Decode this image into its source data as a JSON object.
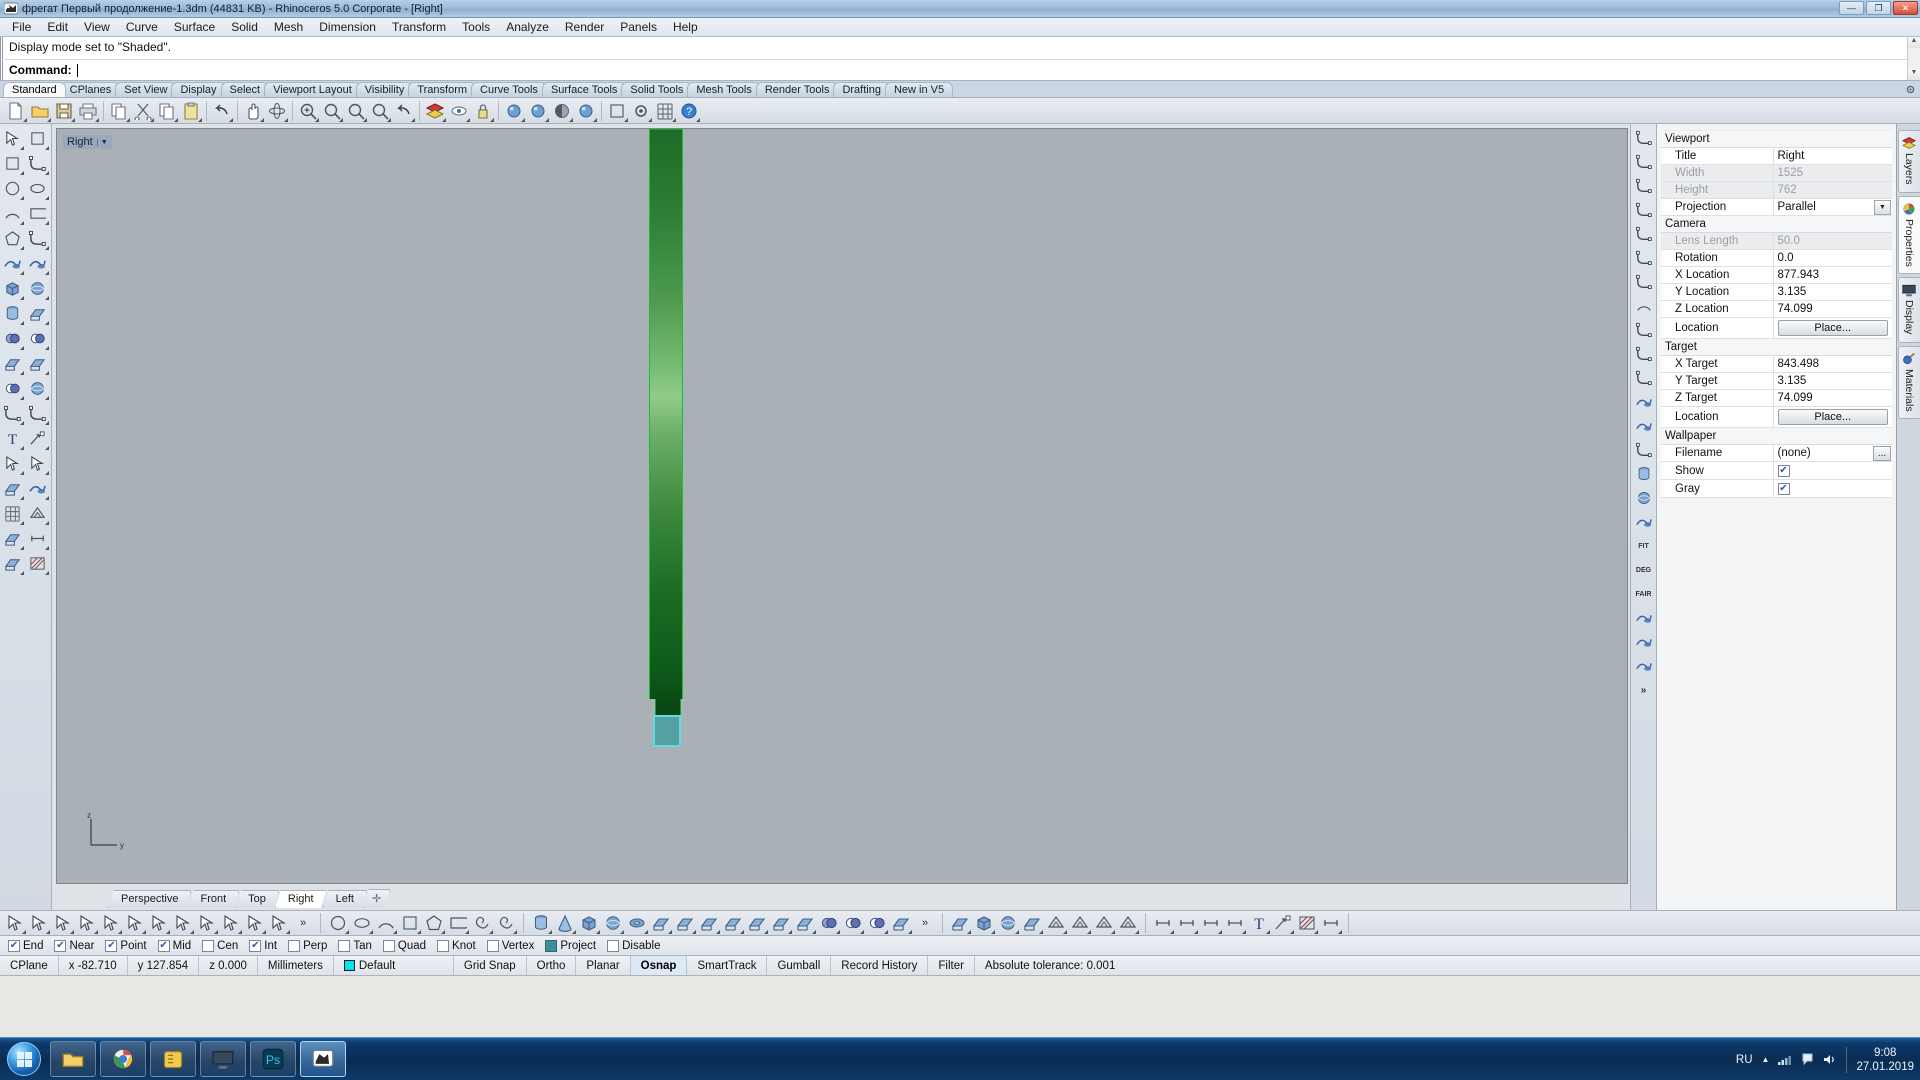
{
  "window": {
    "title": "фрегат Первый продолжение-1.3dm (44831 KB) - Rhinoceros  5.0 Corporate - [Right]",
    "icon": "rhino-app-icon",
    "minimize": "—",
    "maximize": "❐",
    "close": "✕"
  },
  "menubar": {
    "items": [
      "File",
      "Edit",
      "View",
      "Curve",
      "Surface",
      "Solid",
      "Mesh",
      "Dimension",
      "Transform",
      "Tools",
      "Analyze",
      "Render",
      "Panels",
      "Help"
    ]
  },
  "command": {
    "history": "Display mode set to \"Shaded\".",
    "prompt_label": "Command:",
    "input_value": "",
    "scroll_up": "▲",
    "scroll_down": "▼"
  },
  "toolbar_tabs": {
    "items": [
      "Standard",
      "CPlanes",
      "Set View",
      "Display",
      "Select",
      "Viewport Layout",
      "Visibility",
      "Transform",
      "Curve Tools",
      "Surface Tools",
      "Solid Tools",
      "Mesh Tools",
      "Render Tools",
      "Drafting",
      "New in V5"
    ],
    "active": "Standard"
  },
  "main_toolbar": {
    "buttons": [
      "new-file-icon",
      "open-folder-icon",
      "save-icon",
      "print-icon",
      "copy-to-clipboard-icon",
      "cut-scissors-icon",
      "copy-icon",
      "paste-icon",
      "undo-arrow-icon",
      "pan-hand-icon",
      "rotate-view-icon",
      "zoom-in-icon",
      "zoom-window-icon",
      "zoom-extents-icon",
      "zoom-selected-icon",
      "undo-view-icon",
      "layers-icon",
      "hide-objects-icon",
      "lock-objects-icon",
      "render-icon",
      "render-preview-icon",
      "shaded-view-icon",
      "rendered-view-icon",
      "properties-icon",
      "options-gear-icon",
      "grid-snap-icon",
      "help-icon"
    ]
  },
  "viewport": {
    "label": "Right",
    "label_dropdown": "▼",
    "background_color": "#a9b0b6",
    "axis": {
      "z_label": "z",
      "y_label": "y"
    },
    "object": {
      "name": "shaded-green-extrusion",
      "edge_color": "#18c030",
      "selected_block_color": "#55a0a3",
      "selected_edge_color": "#62dbe2"
    },
    "tabs": {
      "items": [
        "Perspective",
        "Front",
        "Top",
        "Right",
        "Left"
      ],
      "active": "Right",
      "add_label": "✛"
    }
  },
  "right_strip": {
    "buttons": [
      "curve-fillet-icon",
      "curve-corner-icon",
      "curve-blend-icon",
      "curve-match-icon",
      "curve-offset-icon",
      "curve-extend-icon",
      "curve-smooth-icon",
      "curve-arc-blend-icon",
      "curve-dot-icon",
      "curve-tangent-icon",
      "curve-end-icon",
      "surface-from-curve-icon",
      "surface-flow-icon",
      "dashed-curve-icon",
      "cylinder-extract-icon",
      "sphere-project-icon",
      "twist-icon",
      "taper-icon",
      "flow-along-curve-icon",
      "flow-along-surface-icon"
    ],
    "labels": [
      "FIT",
      "DEG",
      "FAIR"
    ],
    "overflow": "»"
  },
  "properties_panel": {
    "groups": [
      {
        "name": "Viewport",
        "rows": [
          {
            "key": "Title",
            "value": "Right",
            "type": "text",
            "dim": false
          },
          {
            "key": "Width",
            "value": "1525",
            "type": "text",
            "dim": true
          },
          {
            "key": "Height",
            "value": "762",
            "type": "text",
            "dim": true
          },
          {
            "key": "Projection",
            "value": "Parallel",
            "type": "dropdown",
            "dim": false
          }
        ]
      },
      {
        "name": "Camera",
        "rows": [
          {
            "key": "Lens Length",
            "value": "50.0",
            "type": "text",
            "dim": true
          },
          {
            "key": "Rotation",
            "value": "0.0",
            "type": "text",
            "dim": false
          },
          {
            "key": "X Location",
            "value": "877.943",
            "type": "text",
            "dim": false
          },
          {
            "key": "Y Location",
            "value": "3.135",
            "type": "text",
            "dim": false
          },
          {
            "key": "Z Location",
            "value": "74.099",
            "type": "text",
            "dim": false
          },
          {
            "key": "Location",
            "value": "Place...",
            "type": "button",
            "dim": false
          }
        ]
      },
      {
        "name": "Target",
        "rows": [
          {
            "key": "X Target",
            "value": "843.498",
            "type": "text",
            "dim": false
          },
          {
            "key": "Y Target",
            "value": "3.135",
            "type": "text",
            "dim": false
          },
          {
            "key": "Z Target",
            "value": "74.099",
            "type": "text",
            "dim": false
          },
          {
            "key": "Location",
            "value": "Place...",
            "type": "button",
            "dim": false
          }
        ]
      },
      {
        "name": "Wallpaper",
        "rows": [
          {
            "key": "Filename",
            "value": "(none)",
            "type": "file",
            "dim": false
          },
          {
            "key": "Show",
            "value": "",
            "type": "checkbox",
            "checked": true,
            "dim": false
          },
          {
            "key": "Gray",
            "value": "",
            "type": "checkbox",
            "checked": true,
            "dim": false
          }
        ]
      }
    ],
    "dropdown_glyph": "▼",
    "file_glyph": "...",
    "check_glyph": "✔"
  },
  "panel_tabs": {
    "items": [
      {
        "label": "Layers",
        "icon": "layers-icon",
        "active": false
      },
      {
        "label": "Properties",
        "icon": "properties-color-wheel-icon",
        "active": true
      },
      {
        "label": "Display",
        "icon": "display-monitor-icon",
        "active": false
      },
      {
        "label": "Materials",
        "icon": "materials-sphere-icon",
        "active": false
      }
    ],
    "gear": "gear-icon"
  },
  "bottom_toolbar": {
    "group1": [
      "select-object-icon",
      "select-curve-icon",
      "select-polyline-icon",
      "select-surface-icon",
      "select-polysurface-icon",
      "select-mesh-icon",
      "select-points-icon",
      "select-by-layer-icon",
      "invert-selection-icon",
      "select-all-icon",
      "select-none-icon",
      "select-prev-icon"
    ],
    "group1_overflow": "»",
    "group2": [
      "circle-icon",
      "ellipse-icon",
      "arc-icon",
      "curve-icon",
      "polygon-icon",
      "rounded-rect-icon",
      "spiral-icon",
      "helix-icon"
    ],
    "group3": [
      "cylinder-icon",
      "cone-icon",
      "box-icon",
      "sphere-icon",
      "torus-icon",
      "pipe-icon",
      "extrude-icon",
      "revolve-icon",
      "loft-icon",
      "sweep1-icon",
      "sweep2-icon",
      "patch-icon",
      "boolean-union-icon",
      "boolean-difference-icon",
      "boolean-intersect-icon",
      "shell-icon"
    ],
    "group3_overflow": "»",
    "group4": [
      "mesh-from-surface-icon",
      "mesh-box-icon",
      "mesh-sphere-icon",
      "mesh-plane-icon",
      "reduce-mesh-icon",
      "weld-mesh-icon",
      "unify-normals-icon",
      "mesh-split-icon"
    ],
    "group5": [
      "dim-linear-icon",
      "dim-aligned-icon",
      "dim-radius-icon",
      "dim-angle-icon",
      "text-icon",
      "leader-icon",
      "hatch-icon",
      "detail-icon"
    ]
  },
  "osnap": {
    "items": [
      {
        "label": "End",
        "checked": true
      },
      {
        "label": "Near",
        "checked": true
      },
      {
        "label": "Point",
        "checked": true
      },
      {
        "label": "Mid",
        "checked": true
      },
      {
        "label": "Cen",
        "checked": false
      },
      {
        "label": "Int",
        "checked": true
      },
      {
        "label": "Perp",
        "checked": false
      },
      {
        "label": "Tan",
        "checked": false
      },
      {
        "label": "Quad",
        "checked": false
      },
      {
        "label": "Knot",
        "checked": false
      },
      {
        "label": "Vertex",
        "checked": false
      },
      {
        "label": "Project",
        "checked": false,
        "highlight": true
      },
      {
        "label": "Disable",
        "checked": false
      }
    ],
    "check_glyph": "✔"
  },
  "statusbar": {
    "cplane_label": "CPlane",
    "x": "x -82.710",
    "y": "y 127.854",
    "z": "z 0.000",
    "units": "Millimeters",
    "layer_name": "Default",
    "layer_color": "#00e5f0",
    "toggles": [
      {
        "label": "Grid Snap",
        "active": false
      },
      {
        "label": "Ortho",
        "active": false
      },
      {
        "label": "Planar",
        "active": false
      },
      {
        "label": "Osnap",
        "active": true
      },
      {
        "label": "SmartTrack",
        "active": false
      },
      {
        "label": "Gumball",
        "active": false
      },
      {
        "label": "Record History",
        "active": false
      },
      {
        "label": "Filter",
        "active": false
      }
    ],
    "tolerance": "Absolute tolerance: 0.001"
  },
  "taskbar": {
    "start_icon": "windows-start-orb",
    "items": [
      {
        "icon": "explorer-folder-icon",
        "active": false
      },
      {
        "icon": "chrome-browser-icon",
        "active": false
      },
      {
        "icon": "winrar-icon",
        "active": false
      },
      {
        "icon": "media-player-icon",
        "active": false
      },
      {
        "icon": "photoshop-icon",
        "active": false
      },
      {
        "icon": "rhino-icon",
        "active": true
      }
    ],
    "tray": {
      "language": "RU",
      "show_hidden": "▲",
      "network_icon": "network-icon",
      "flag_icon": "action-center-flag-icon",
      "volume_icon": "volume-icon",
      "time": "9:08",
      "date": "27.01.2019"
    }
  }
}
